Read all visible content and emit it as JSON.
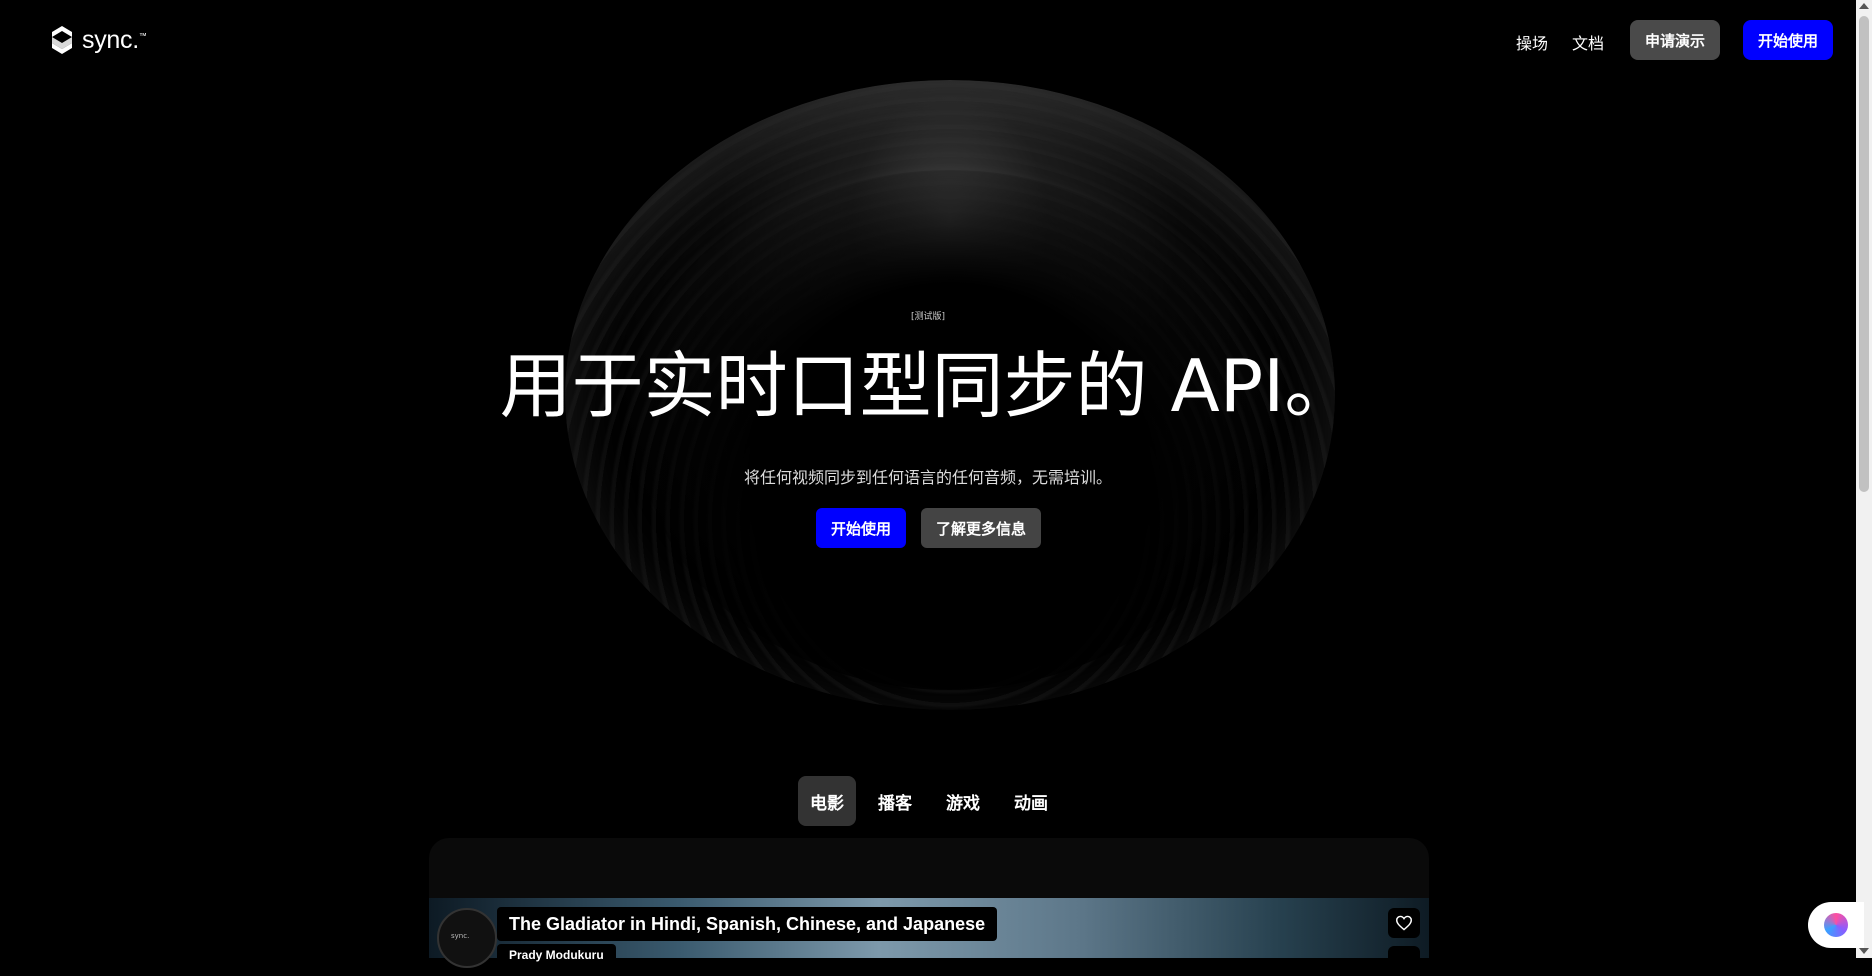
{
  "header": {
    "logo_text": "sync.",
    "logo_tm": "™",
    "nav": [
      "操场",
      "文档"
    ],
    "demo_button": "申请演示",
    "start_button": "开始使用"
  },
  "hero": {
    "beta": "[测试版]",
    "title": "用于实时口型同步的 API。",
    "subtitle": "将任何视频同步到任何语言的任何音频，无需培训。",
    "cta_start": "开始使用",
    "cta_more": "了解更多信息"
  },
  "tabs": [
    {
      "label": "电影",
      "active": true
    },
    {
      "label": "播客",
      "active": false
    },
    {
      "label": "游戏",
      "active": false
    },
    {
      "label": "动画",
      "active": false
    }
  ],
  "video": {
    "title": "The Gladiator in Hindi, Spanish, Chinese, and Japanese",
    "author": "Prady Modukuru",
    "avatar_text": "sync."
  },
  "icons": {
    "logo": "sync-logo-icon",
    "like": "heart-icon",
    "assistant": "assistant-brain-icon"
  },
  "colors": {
    "background": "#000000",
    "accent_blue": "#0000ff",
    "secondary_gray": "#4a4a4a"
  }
}
